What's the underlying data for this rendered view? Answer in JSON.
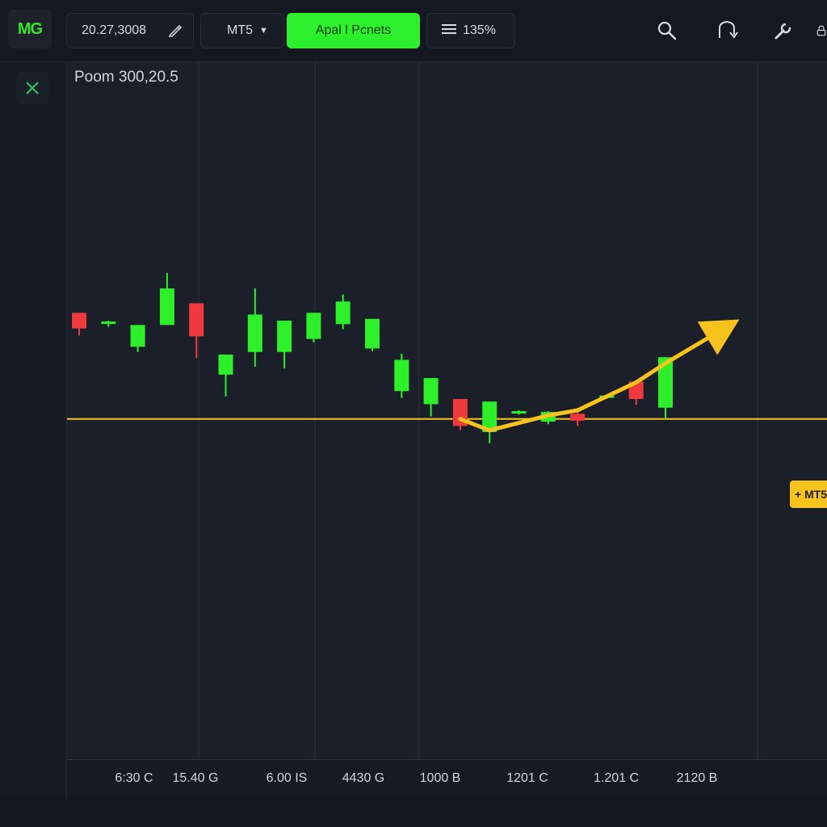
{
  "toolbar": {
    "logo": "MG",
    "date_value": "20.27,3008",
    "symbol": "MT5",
    "action_label": "Apal l Pcnets",
    "zoom_label": "135%",
    "icons": [
      "search-icon",
      "refresh-icon",
      "wrench-icon",
      "lock-icon"
    ]
  },
  "rail": {
    "close_icon": "close-icon"
  },
  "chart": {
    "label": "Poom 300,20.5",
    "price_tag": "+ MT5",
    "colors": {
      "up": "#2df02a",
      "down": "#f0393c",
      "accent": "#f7c31c",
      "grid": "#2e3440"
    }
  },
  "chart_data": {
    "type": "candlestick",
    "x_tick_labels": [
      "6:30 C",
      "15.40 G",
      "6.00 IS",
      "4430 G",
      "1000 B",
      "1201 C",
      "1.201 C",
      "2120 B"
    ],
    "candles": [
      {
        "o": 71.2,
        "c": 69.4,
        "h": 71.2,
        "l": 68.6,
        "dir": "down"
      },
      {
        "o": 70.2,
        "c": 70.1,
        "h": 70.3,
        "l": 69.6,
        "dir": "up"
      },
      {
        "o": 67.3,
        "c": 69.8,
        "h": 69.8,
        "l": 66.7,
        "dir": "up"
      },
      {
        "o": 69.8,
        "c": 74.0,
        "h": 75.8,
        "l": 69.8,
        "dir": "up"
      },
      {
        "o": 72.3,
        "c": 68.5,
        "h": 72.3,
        "l": 66.0,
        "dir": "down"
      },
      {
        "o": 64.1,
        "c": 66.4,
        "h": 66.4,
        "l": 61.6,
        "dir": "up"
      },
      {
        "o": 66.7,
        "c": 71.0,
        "h": 74.0,
        "l": 65.0,
        "dir": "up"
      },
      {
        "o": 66.7,
        "c": 70.3,
        "h": 70.3,
        "l": 64.8,
        "dir": "up"
      },
      {
        "o": 68.2,
        "c": 71.2,
        "h": 71.2,
        "l": 67.8,
        "dir": "up"
      },
      {
        "o": 69.9,
        "c": 72.5,
        "h": 73.3,
        "l": 69.3,
        "dir": "up"
      },
      {
        "o": 67.1,
        "c": 70.5,
        "h": 70.5,
        "l": 66.8,
        "dir": "up"
      },
      {
        "o": 62.2,
        "c": 65.8,
        "h": 66.5,
        "l": 61.4,
        "dir": "up"
      },
      {
        "o": 60.7,
        "c": 63.7,
        "h": 63.7,
        "l": 59.3,
        "dir": "up"
      },
      {
        "o": 61.3,
        "c": 58.2,
        "h": 61.3,
        "l": 57.7,
        "dir": "down"
      },
      {
        "o": 57.5,
        "c": 61.0,
        "h": 61.0,
        "l": 56.2,
        "dir": "up"
      },
      {
        "o": 59.7,
        "c": 59.9,
        "h": 60.0,
        "l": 59.5,
        "dir": "up"
      },
      {
        "o": 58.7,
        "c": 59.8,
        "h": 59.9,
        "l": 58.4,
        "dir": "up"
      },
      {
        "o": 59.6,
        "c": 58.8,
        "h": 59.8,
        "l": 58.2,
        "dir": "down"
      },
      {
        "o": 61.5,
        "c": 61.7,
        "h": 61.8,
        "l": 61.3,
        "dir": "up"
      },
      {
        "o": 63.3,
        "c": 61.3,
        "h": 63.3,
        "l": 60.6,
        "dir": "down"
      },
      {
        "o": 60.3,
        "c": 66.1,
        "h": 66.1,
        "l": 59.0,
        "dir": "up"
      }
    ],
    "horizontal_line": 59.0,
    "trend_path": [
      [
        13,
        59.0
      ],
      [
        14,
        57.7
      ],
      [
        16,
        59.4
      ],
      [
        17,
        60.0
      ],
      [
        19,
        63.2
      ],
      [
        20,
        65.4
      ],
      [
        22,
        69.4
      ]
    ],
    "grid": true,
    "ylim": [
      20,
      100
    ]
  }
}
